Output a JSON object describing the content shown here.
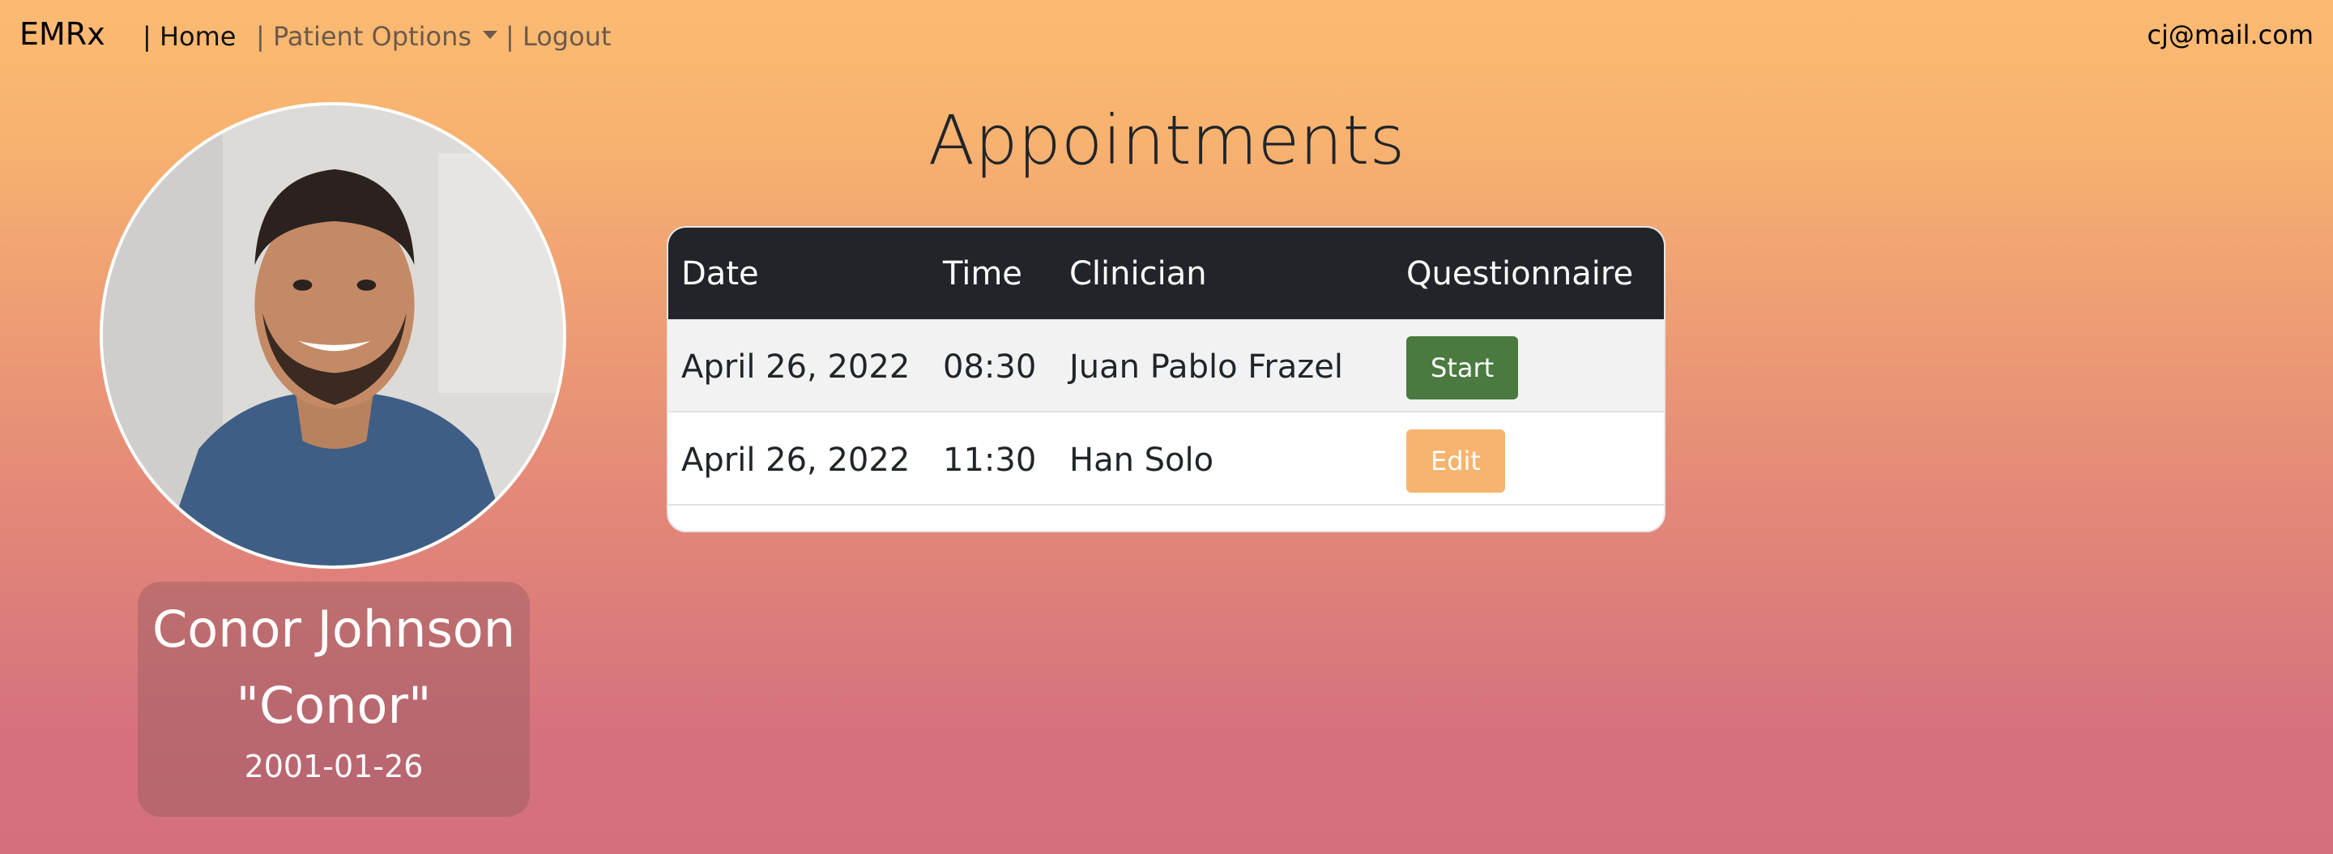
{
  "nav": {
    "brand": "EMRx",
    "home": "| Home",
    "patient_options": "| Patient Options",
    "logout": "| Logout",
    "user_email": "cj@mail.com"
  },
  "profile": {
    "name": "Conor Johnson",
    "nickname": "\"Conor\"",
    "dob": "2001-01-26"
  },
  "page": {
    "title": "Appointments"
  },
  "table": {
    "headers": [
      "Date",
      "Time",
      "Clinician",
      "Questionnaire"
    ],
    "rows": [
      {
        "date": "April 26, 2022",
        "time": "08:30",
        "clinician": "Juan Pablo Frazel",
        "action": "Start",
        "action_color": "#4a7a3f"
      },
      {
        "date": "April 26, 2022",
        "time": "11:30",
        "clinician": "Han Solo",
        "action": "Edit",
        "action_color": "#f7b46e"
      }
    ]
  },
  "colors": {
    "gradient_top": "#fbba72",
    "gradient_bottom": "#d46f80",
    "table_header": "#212529"
  }
}
